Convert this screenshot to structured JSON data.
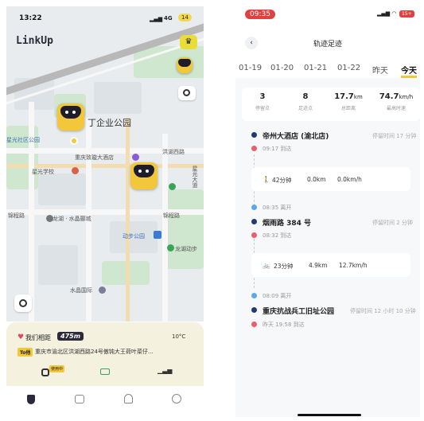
{
  "left": {
    "status": {
      "time": "13:22",
      "network": "4G",
      "battery": "14"
    },
    "app_logo": "LinkUp",
    "map": {
      "labels": {
        "poi1": "丁企业公园",
        "community": "星光社区公园",
        "hotel": "重庆致璇大酒店",
        "road_hongjie": "洪湖西路",
        "school": "星光学校",
        "road_xingguang": "星光大道",
        "road_jinkai": "锦程路",
        "mail": "龙湖 · 水晶郦城",
        "road_jinzhou": "锦程路",
        "park": "动步公园",
        "longhu": "龙湖动步",
        "crystal": "水晶国际",
        "road_a": "园",
        "road_b": "园"
      }
    },
    "card": {
      "distance_label": "我们相距",
      "distance_value": "475m",
      "weather": "10°C",
      "to_tag": "To他",
      "address": "重庆市渝北区洪湖西路24号傲钝大王荷叶菜仔...",
      "status_tag": "使用中"
    }
  },
  "right": {
    "status": {
      "time": "09:35",
      "battery": "15+"
    },
    "title": "轨迹足迹",
    "dates": [
      "01-19",
      "01-20",
      "01-21",
      "01-22",
      "昨天",
      "今天"
    ],
    "stats": [
      {
        "value": "3",
        "unit": "",
        "label": "停留点"
      },
      {
        "value": "8",
        "unit": "",
        "label": "足迹点"
      },
      {
        "value": "17.7",
        "unit": "km",
        "label": "总距离"
      },
      {
        "value": "74.7",
        "unit": "km/h",
        "label": "最高时速"
      }
    ],
    "timeline": {
      "p1_name": "帝州大酒店 (渝北店)",
      "p1_stay": "停留时间 17 分钟",
      "p1_arrive": "09:17 到达",
      "m1_time": "42分钟",
      "m1_dist": "0.0km",
      "m1_speed": "0.0km/h",
      "p2_leave": "08:35 离开",
      "p2_name": "烟雨路 384 号",
      "p2_stay": "停留时间 2 分钟",
      "p2_arrive": "08:32 到达",
      "m2_time": "23分钟",
      "m2_dist": "4.9km",
      "m2_speed": "12.7km/h",
      "p3_leave": "08:09 离开",
      "p3_name": "重庆抗战兵工旧址公园",
      "p3_stay": "停留时间 12 小时 10 分钟",
      "p3_arrive": "昨天 19:58 到达"
    }
  },
  "colors": {
    "brand_yellow": "#f2c73a",
    "dot_blue": "#1f3b73",
    "dot_red": "#e85f6a",
    "accent_red_pill": "#e04040"
  }
}
